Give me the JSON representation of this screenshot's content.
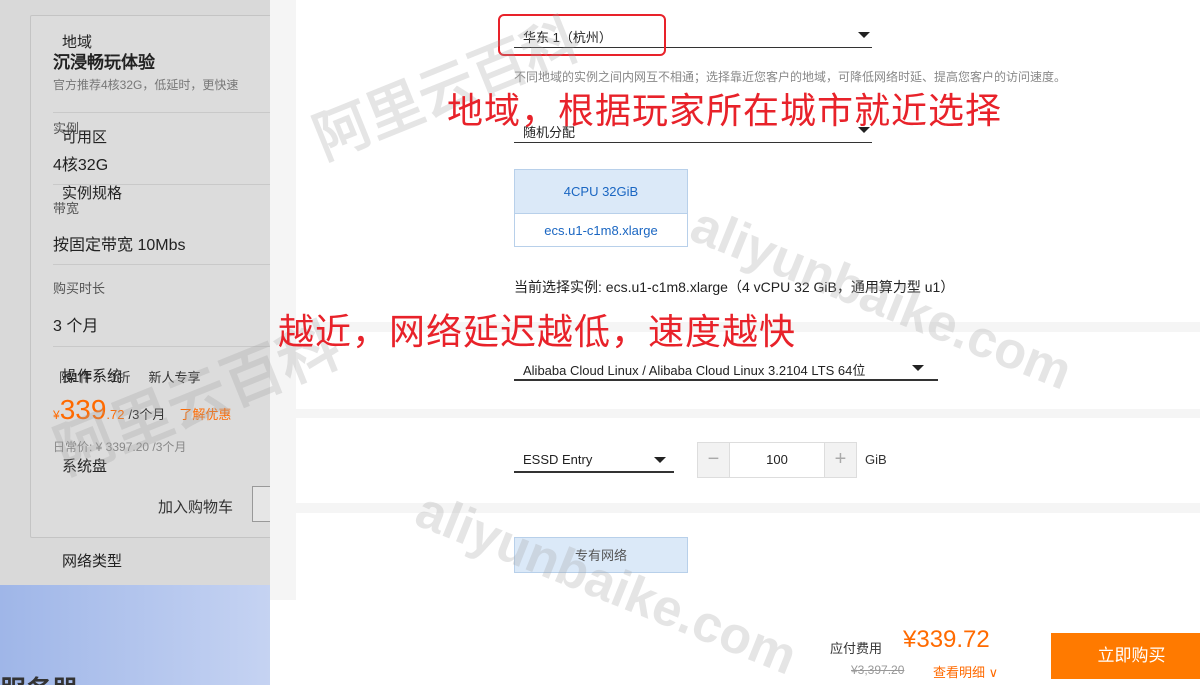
{
  "background_card": {
    "title": "沉浸畅玩体验",
    "subtitle": "官方推荐4核32G，低延时，更快速",
    "instance_label": "实例",
    "instance_value": "4核32G",
    "bandwidth_label": "带宽",
    "bandwidth_value": "按固定带宽 10Mbs",
    "duration_label": "购买时长",
    "duration_value": "3 个月",
    "tags": [
      "限1件",
      "1折",
      "新人专享"
    ],
    "price_symbol": "¥",
    "price_int": "339",
    "price_dec": ".72",
    "price_period": "/3个月",
    "promo_link": "了解优惠",
    "original_price": "日常价: ¥ 3397.20 /3个月",
    "add_to_cart": "加入购物车",
    "bottom_text": "服务器"
  },
  "form": {
    "region": {
      "label": "地域",
      "value": "华东 1（杭州）",
      "hint": "不同地域的实例之间内网互不相通；选择靠近您客户的地域，可降低网络时延、提高您客户的访问速度。"
    },
    "zone": {
      "label": "可用区",
      "value": "随机分配"
    },
    "spec": {
      "label": "实例规格",
      "cpu_mem": "4CPU 32GiB",
      "type_name": "ecs.u1-c1m8.xlarge",
      "current": "当前选择实例: ecs.u1-c1m8.xlarge（4 vCPU 32 GiB，通用算力型 u1）"
    },
    "os": {
      "label": "操作系统",
      "value": "Alibaba Cloud Linux / Alibaba Cloud Linux 3.2104 LTS 64位"
    },
    "disk": {
      "label": "系统盘",
      "type": "ESSD Entry",
      "minus": "−",
      "size": "100",
      "plus": "+",
      "unit": "GiB"
    },
    "network": {
      "label": "网络类型",
      "value": "专有网络"
    }
  },
  "footer": {
    "fee_label": "应付费用",
    "fee_value": "¥339.72",
    "fee_original": "¥3,397.20",
    "details": "查看明细 ∨",
    "buy_button": "立即购买"
  },
  "annotations": {
    "region_note": "地域，根据玩家所在城市就近选择",
    "latency_note": "越近，网络延迟越低，速度越快"
  },
  "watermarks": {
    "cn": "阿里云百科",
    "en": "aliyunbaike.com"
  },
  "colors": {
    "accent_orange": "#ff6a00",
    "annotation_red": "#e8222a",
    "selected_blue": "#1a66c2"
  }
}
